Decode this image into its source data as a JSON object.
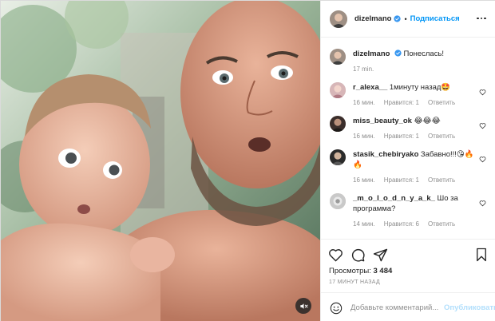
{
  "post": {
    "username": "dizelmano",
    "follow_label": "Подписаться",
    "separator": "•",
    "caption": {
      "username": "dizelmano",
      "text": "Понеслась!",
      "time": "17 min."
    }
  },
  "comments": [
    {
      "username": "r_alexa__",
      "text": "1минуту назад🤩",
      "time": "16 мин.",
      "likes": "Нравится: 1",
      "reply": "Ответить"
    },
    {
      "username": "miss_beauty_ok",
      "text": "😂😂😂",
      "time": "16 мин.",
      "likes": "Нравится: 1",
      "reply": "Ответить"
    },
    {
      "username": "stasik_chebiryako",
      "text": "Забавно!!!😘🔥🔥",
      "time": "16 мин.",
      "likes": "Нравится: 1",
      "reply": "Ответить"
    },
    {
      "username": "_m_o_l_o_d_n_y_a_k_",
      "text": "Шо за программа?",
      "time": "14 мин.",
      "likes": "Нравится: 6",
      "reply": "Ответить"
    }
  ],
  "actions": {
    "views_label": "Просмотры:",
    "views_count": "3 484",
    "posted_ago": "17 МИНУТ НАЗАД"
  },
  "add_comment": {
    "placeholder": "Добавьте комментарий...",
    "publish_label": "Опубликовать"
  },
  "icons": {
    "like": "heart-icon",
    "comment": "comment-icon",
    "share": "share-icon",
    "save": "bookmark-icon",
    "emoji": "emoji-icon",
    "mute": "speaker-muted-icon",
    "more": "more-options-icon",
    "verified": "verified-badge-icon"
  },
  "colors": {
    "accent": "#0095f6",
    "verified": "#3897f0",
    "muted_text": "#8e8e8e",
    "publish_disabled": "#b2dffc"
  }
}
